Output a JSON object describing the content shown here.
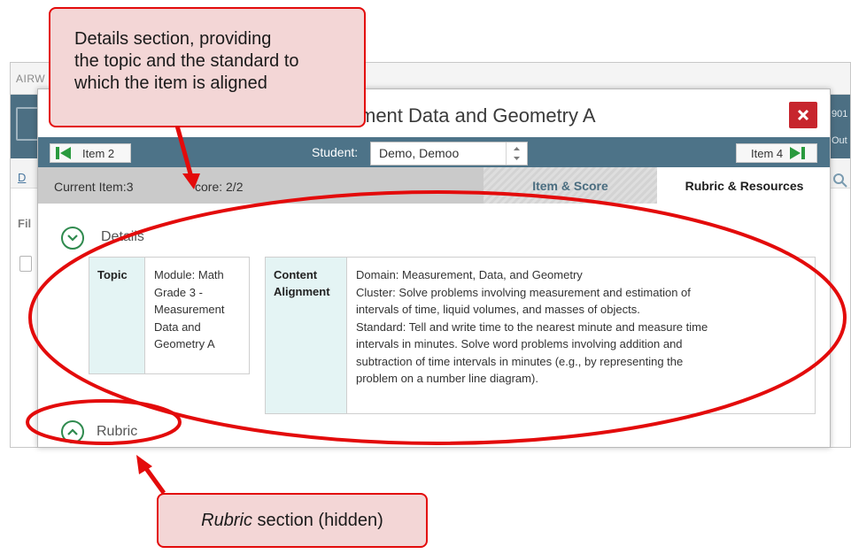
{
  "background_app": {
    "topbar_text": "AIRW",
    "header_right_top": "901",
    "header_right_bottom": "Out",
    "subbar_link": "D",
    "filter_label": "Fil"
  },
  "modal": {
    "title": "ment Data and Geometry A",
    "prev_item": "Item 2",
    "next_item": "Item 4",
    "student_label": "Student:",
    "student_value": "Demo, Demoo",
    "current_item": "Current Item:3",
    "score": "core: 2/2",
    "tabs": [
      "Item & Score",
      "Rubric & Resources"
    ],
    "details_title": "Details",
    "rubric_title": "Rubric",
    "topic_label": "Topic",
    "topic_value": [
      "Module: Math",
      "Grade 3 -",
      "Measurement",
      "Data and",
      "Geometry A"
    ],
    "alignment_label": [
      "Content",
      "Alignment"
    ],
    "alignment_value": [
      "Domain: Measurement, Data, and Geometry",
      "Cluster: Solve problems involving measurement and estimation of",
      "intervals of time, liquid volumes, and masses of objects.",
      "Standard: Tell and write time to the nearest minute and measure time",
      "intervals in minutes. Solve word problems involving addition and",
      "subtraction of time intervals in minutes (e.g., by representing the",
      "problem on a number line diagram)."
    ]
  },
  "annotations": {
    "top_callout": [
      "Details section, providing",
      "the topic and the standard to",
      "which the item is aligned"
    ],
    "bottom_callout_italic": "Rubric",
    "bottom_callout_rest": " section (hidden)"
  },
  "colors": {
    "nav_bar": "#4d7388",
    "close_button": "#c7252d",
    "annotation_red": "#e30b0b",
    "callout_fill": "#f3d6d6",
    "toggle_green": "#2f8a4e"
  }
}
